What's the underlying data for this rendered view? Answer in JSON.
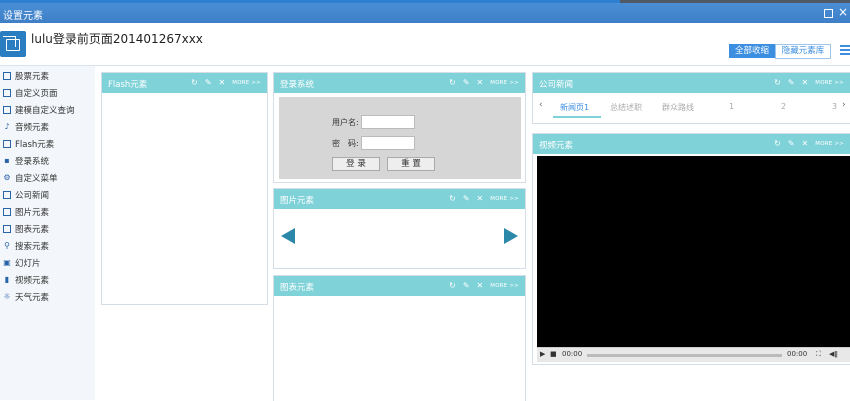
{
  "window": {
    "title": "设置元素"
  },
  "header": {
    "page_title": "lulu登录前页面201401267xxx",
    "collapse_all": "全部收缩",
    "hide_library": "隐藏元素库"
  },
  "sidebar": {
    "items": [
      {
        "label": "股票元素",
        "icon": "chart-icon"
      },
      {
        "label": "自定义页面",
        "icon": "page-icon"
      },
      {
        "label": "建模自定义查询",
        "icon": "query-icon"
      },
      {
        "label": "音频元素",
        "icon": "music-icon"
      },
      {
        "label": "Flash元素",
        "icon": "flash-icon"
      },
      {
        "label": "登录系统",
        "icon": "login-icon"
      },
      {
        "label": "自定义菜单",
        "icon": "menu-icon"
      },
      {
        "label": "公司新闻",
        "icon": "news-icon"
      },
      {
        "label": "图片元素",
        "icon": "image-icon"
      },
      {
        "label": "图表元素",
        "icon": "table-icon"
      },
      {
        "label": "搜索元素",
        "icon": "search-icon"
      },
      {
        "label": "幻灯片",
        "icon": "slides-icon"
      },
      {
        "label": "视频元素",
        "icon": "video-icon"
      },
      {
        "label": "天气元素",
        "icon": "weather-icon"
      }
    ]
  },
  "panels": {
    "flash": {
      "title": "Flash元素"
    },
    "login": {
      "title": "登录系统",
      "username_label": "用户名:",
      "password_label": "密　码:",
      "login_button": "登 录",
      "reset_button": "重 置"
    },
    "image": {
      "title": "图片元素"
    },
    "chart": {
      "title": "图表元素"
    },
    "news": {
      "title": "公司新闻",
      "tabs": [
        "新闻页1",
        "总结述职",
        "群众路线",
        "1",
        "2",
        "3"
      ]
    },
    "video": {
      "title": "视频元素",
      "time_current": "00:00",
      "time_total": "00:00"
    }
  },
  "controls": {
    "more_label": "MORE >>"
  },
  "colors": {
    "panel_header": "#7fd2d8",
    "title_bar": "#3e7fc6",
    "accent": "#3c8ee0"
  }
}
